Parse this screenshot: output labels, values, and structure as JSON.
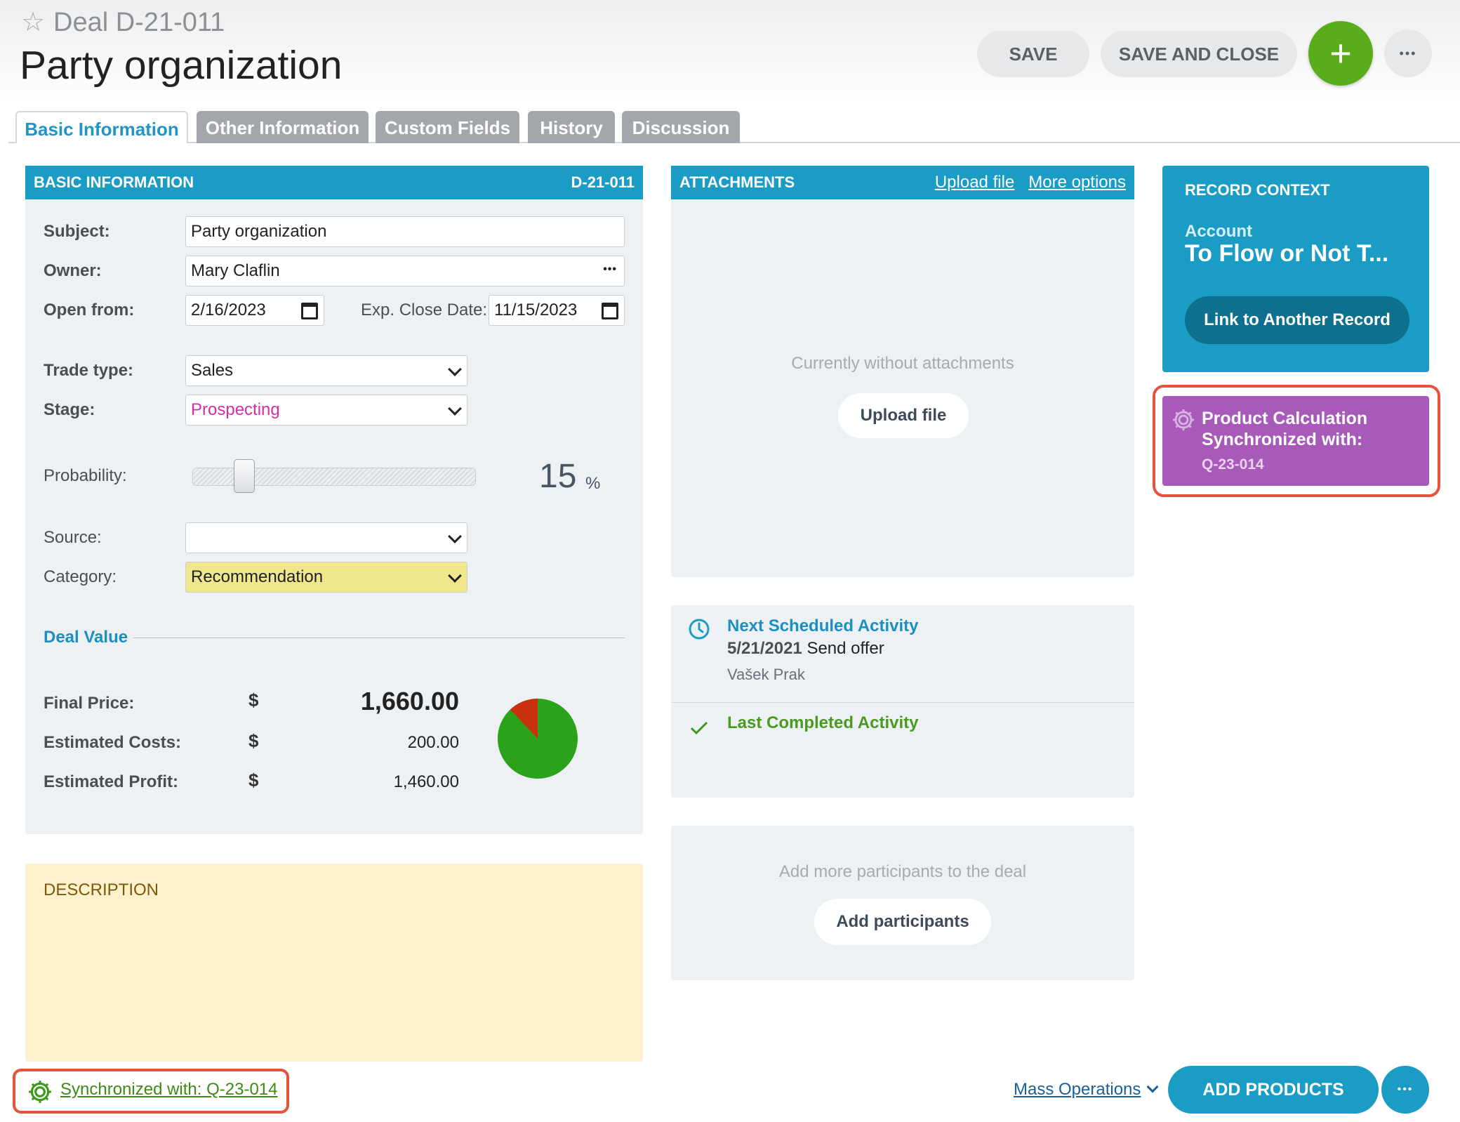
{
  "header": {
    "deal_id": "Deal D-21-011",
    "title": "Party organization",
    "save": "SAVE",
    "save_close": "SAVE AND CLOSE",
    "add_symbol": "+",
    "more_symbol": "•••"
  },
  "tabs": [
    "Basic Information",
    "Other Information",
    "Custom Fields",
    "History",
    "Discussion"
  ],
  "basic": {
    "heading": "BASIC INFORMATION",
    "record_id": "D-21-011",
    "subject_label": "Subject:",
    "subject_value": "Party organization",
    "owner_label": "Owner:",
    "owner_value": "Mary Claflin",
    "owner_more": "•••",
    "open_from_label": "Open from:",
    "open_from_value": "2/16/2023",
    "close_label": "Exp. Close Date:",
    "close_value": "11/15/2023",
    "trade_label": "Trade type:",
    "trade_value": "Sales",
    "stage_label": "Stage:",
    "stage_value": "Prospecting",
    "prob_label": "Probability:",
    "prob_value": "15",
    "prob_unit": "%",
    "prob_fraction": 0.15,
    "source_label": "Source:",
    "source_value": "",
    "category_label": "Category:",
    "category_value": "Recommendation"
  },
  "deal_value": {
    "heading": "Deal Value",
    "currency": "$",
    "final_label": "Final Price:",
    "final_value": "1,660.00",
    "costs_label": "Estimated Costs:",
    "costs_value": "200.00",
    "profit_label": "Estimated Profit:",
    "profit_value": "1,460.00",
    "pie": {
      "costs": 200,
      "profit": 1460,
      "costs_color": "#c8300f",
      "profit_color": "#2aa31a"
    }
  },
  "description": {
    "heading": "DESCRIPTION"
  },
  "attachments": {
    "heading": "ATTACHMENTS",
    "upload_link": "Upload file",
    "more_link": "More options",
    "empty_text": "Currently without attachments",
    "upload_button": "Upload file"
  },
  "activity": {
    "next_title": "Next Scheduled Activity",
    "next_date": "5/21/2021",
    "next_text": "Send offer",
    "next_person": "Vašek Prak",
    "last_title": "Last Completed Activity"
  },
  "participants": {
    "empty_text": "Add more participants to the deal",
    "button": "Add participants"
  },
  "context": {
    "heading": "RECORD CONTEXT",
    "account_label": "Account",
    "account_value": "To Flow or Not T...",
    "link_button": "Link to Another Record"
  },
  "sync_card": {
    "line1": "Product Calculation",
    "line2": "Synchronized with:",
    "ref": "Q-23-014"
  },
  "footer": {
    "sync_link": "Synchronized with: Q-23-014",
    "mass_ops": "Mass Operations",
    "add_products": "ADD PRODUCTS",
    "more_symbol": "•••"
  },
  "colors": {
    "accent": "#1a9cc5",
    "add_green": "#5aad1a",
    "sync_purple": "#a75ab8",
    "highlight_red": "#e5533d",
    "category_yellow": "#f0e78c",
    "description_bg": "#fdf0cd"
  }
}
